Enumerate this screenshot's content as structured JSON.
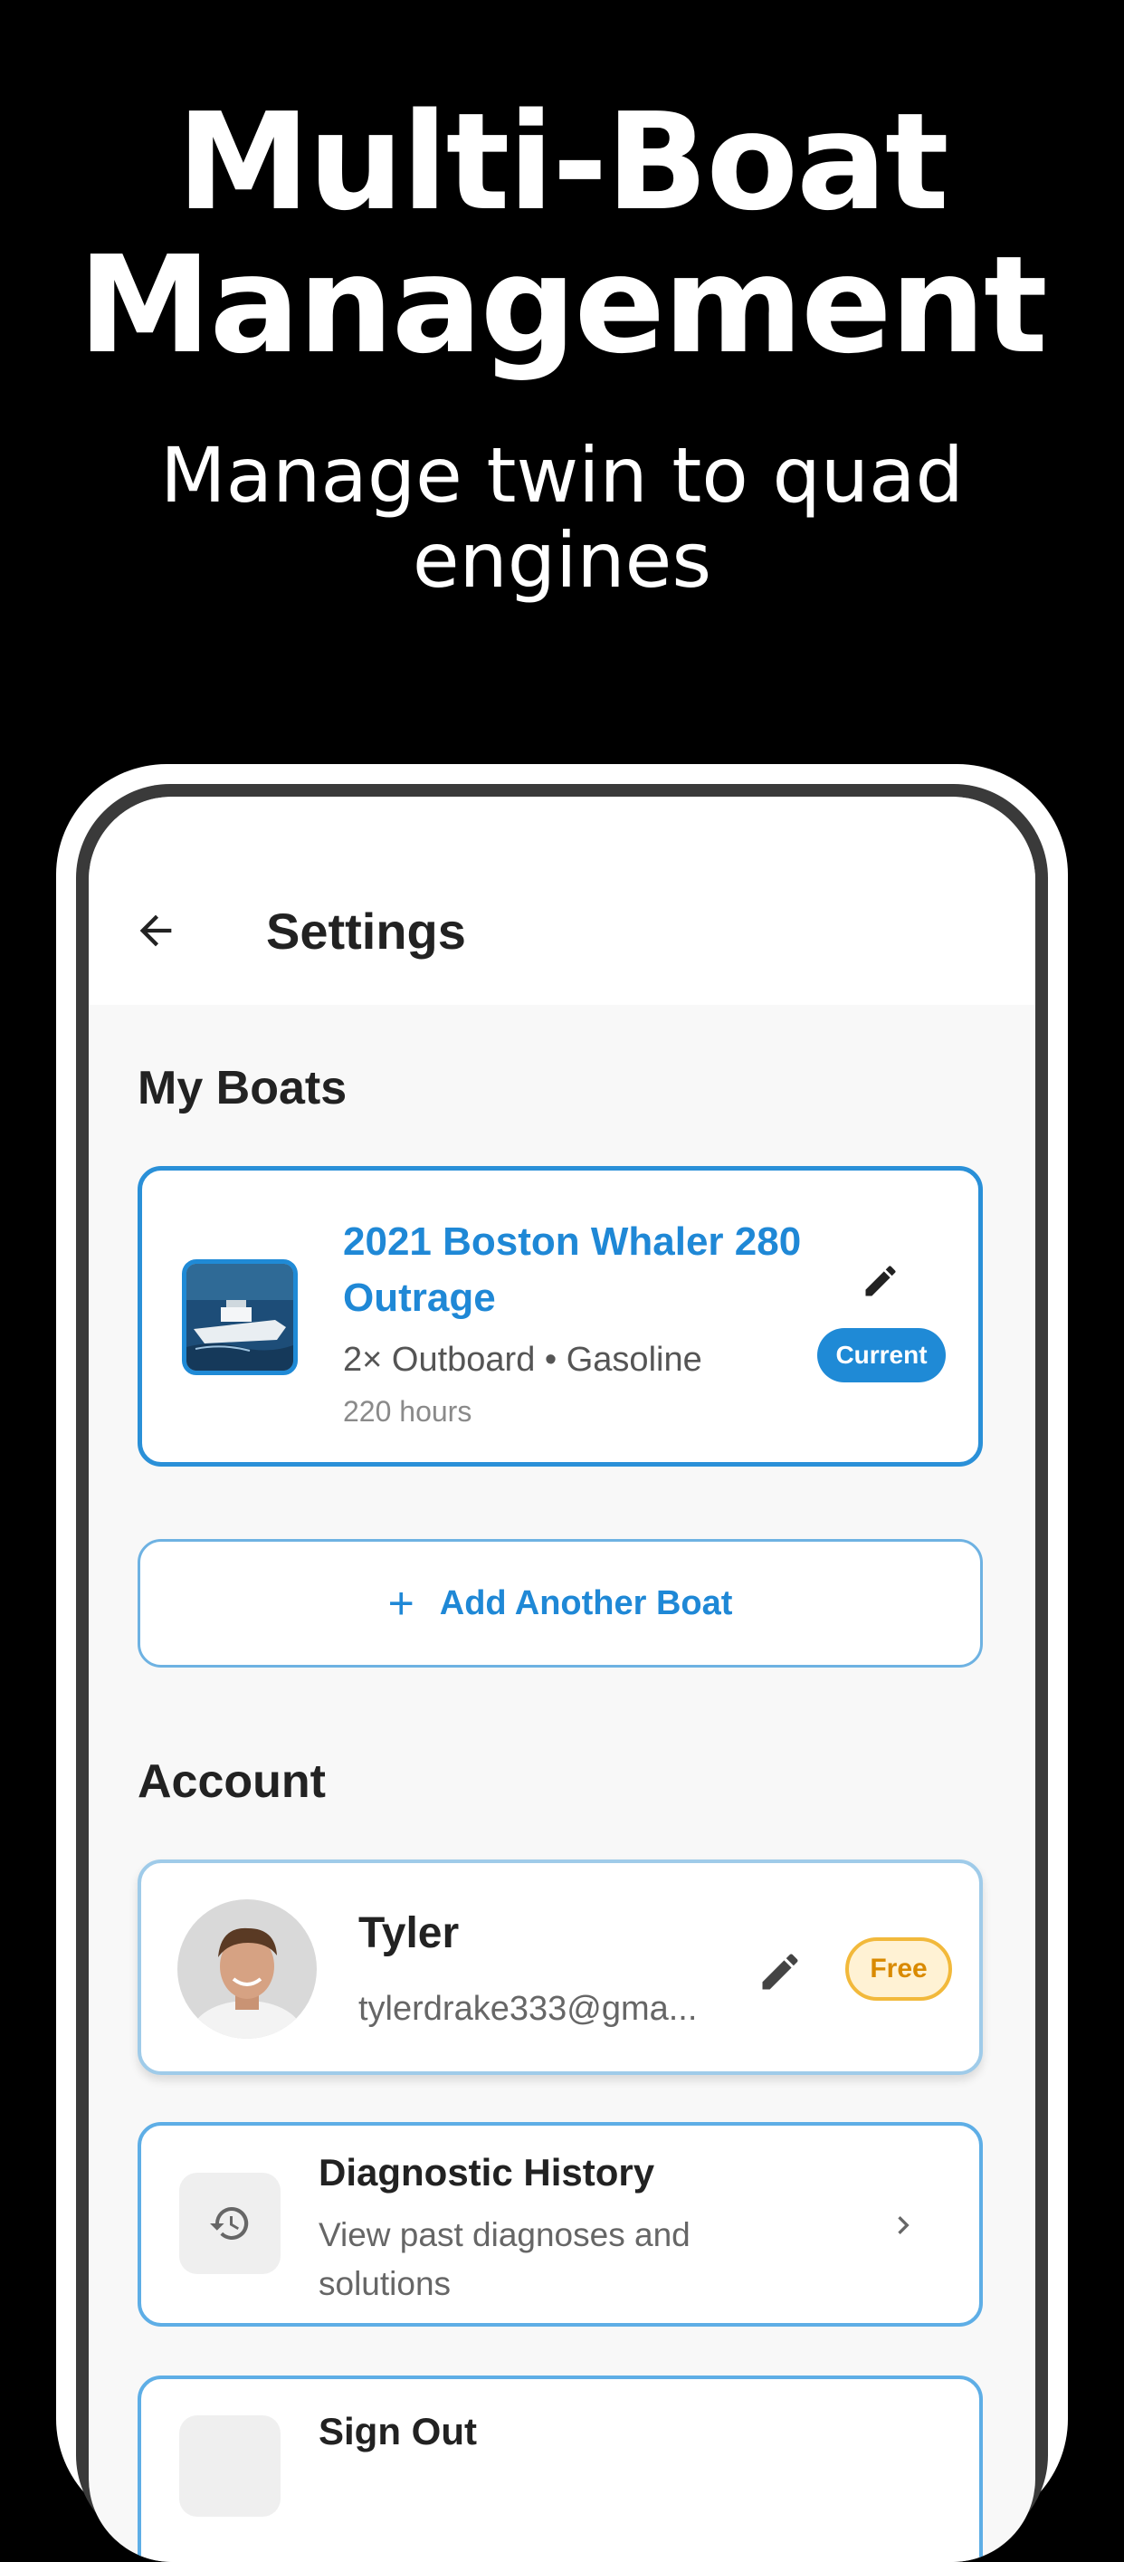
{
  "hero": {
    "title_line1": "Multi-Boat",
    "title_line2": "Management",
    "subtitle": "Manage twin to quad engines"
  },
  "appbar": {
    "title": "Settings"
  },
  "boats": {
    "section_title": "My Boats",
    "current": {
      "name": "2021 Boston Whaler 280 Outrage",
      "meta": "2× Outboard • Gasoline",
      "hours": "220 hours",
      "badge": "Current"
    },
    "add_label": "Add Another Boat"
  },
  "account": {
    "section_title": "Account",
    "user": {
      "name": "Tyler",
      "email": "tylerdrake333@gma...",
      "plan_badge": "Free"
    }
  },
  "menu": {
    "history": {
      "title": "Diagnostic History",
      "desc": "View past diagnoses and solutions"
    },
    "signout": {
      "title": "Sign Out"
    }
  },
  "colors": {
    "accent": "#1f88d6",
    "badge_free_bg": "#fff2d4",
    "badge_free_border": "#f2b93b",
    "background": "#000000"
  },
  "icons": [
    "back-arrow-icon",
    "pencil-icon",
    "plus-icon",
    "history-icon",
    "chevron-right-icon",
    "sign-out-icon"
  ]
}
